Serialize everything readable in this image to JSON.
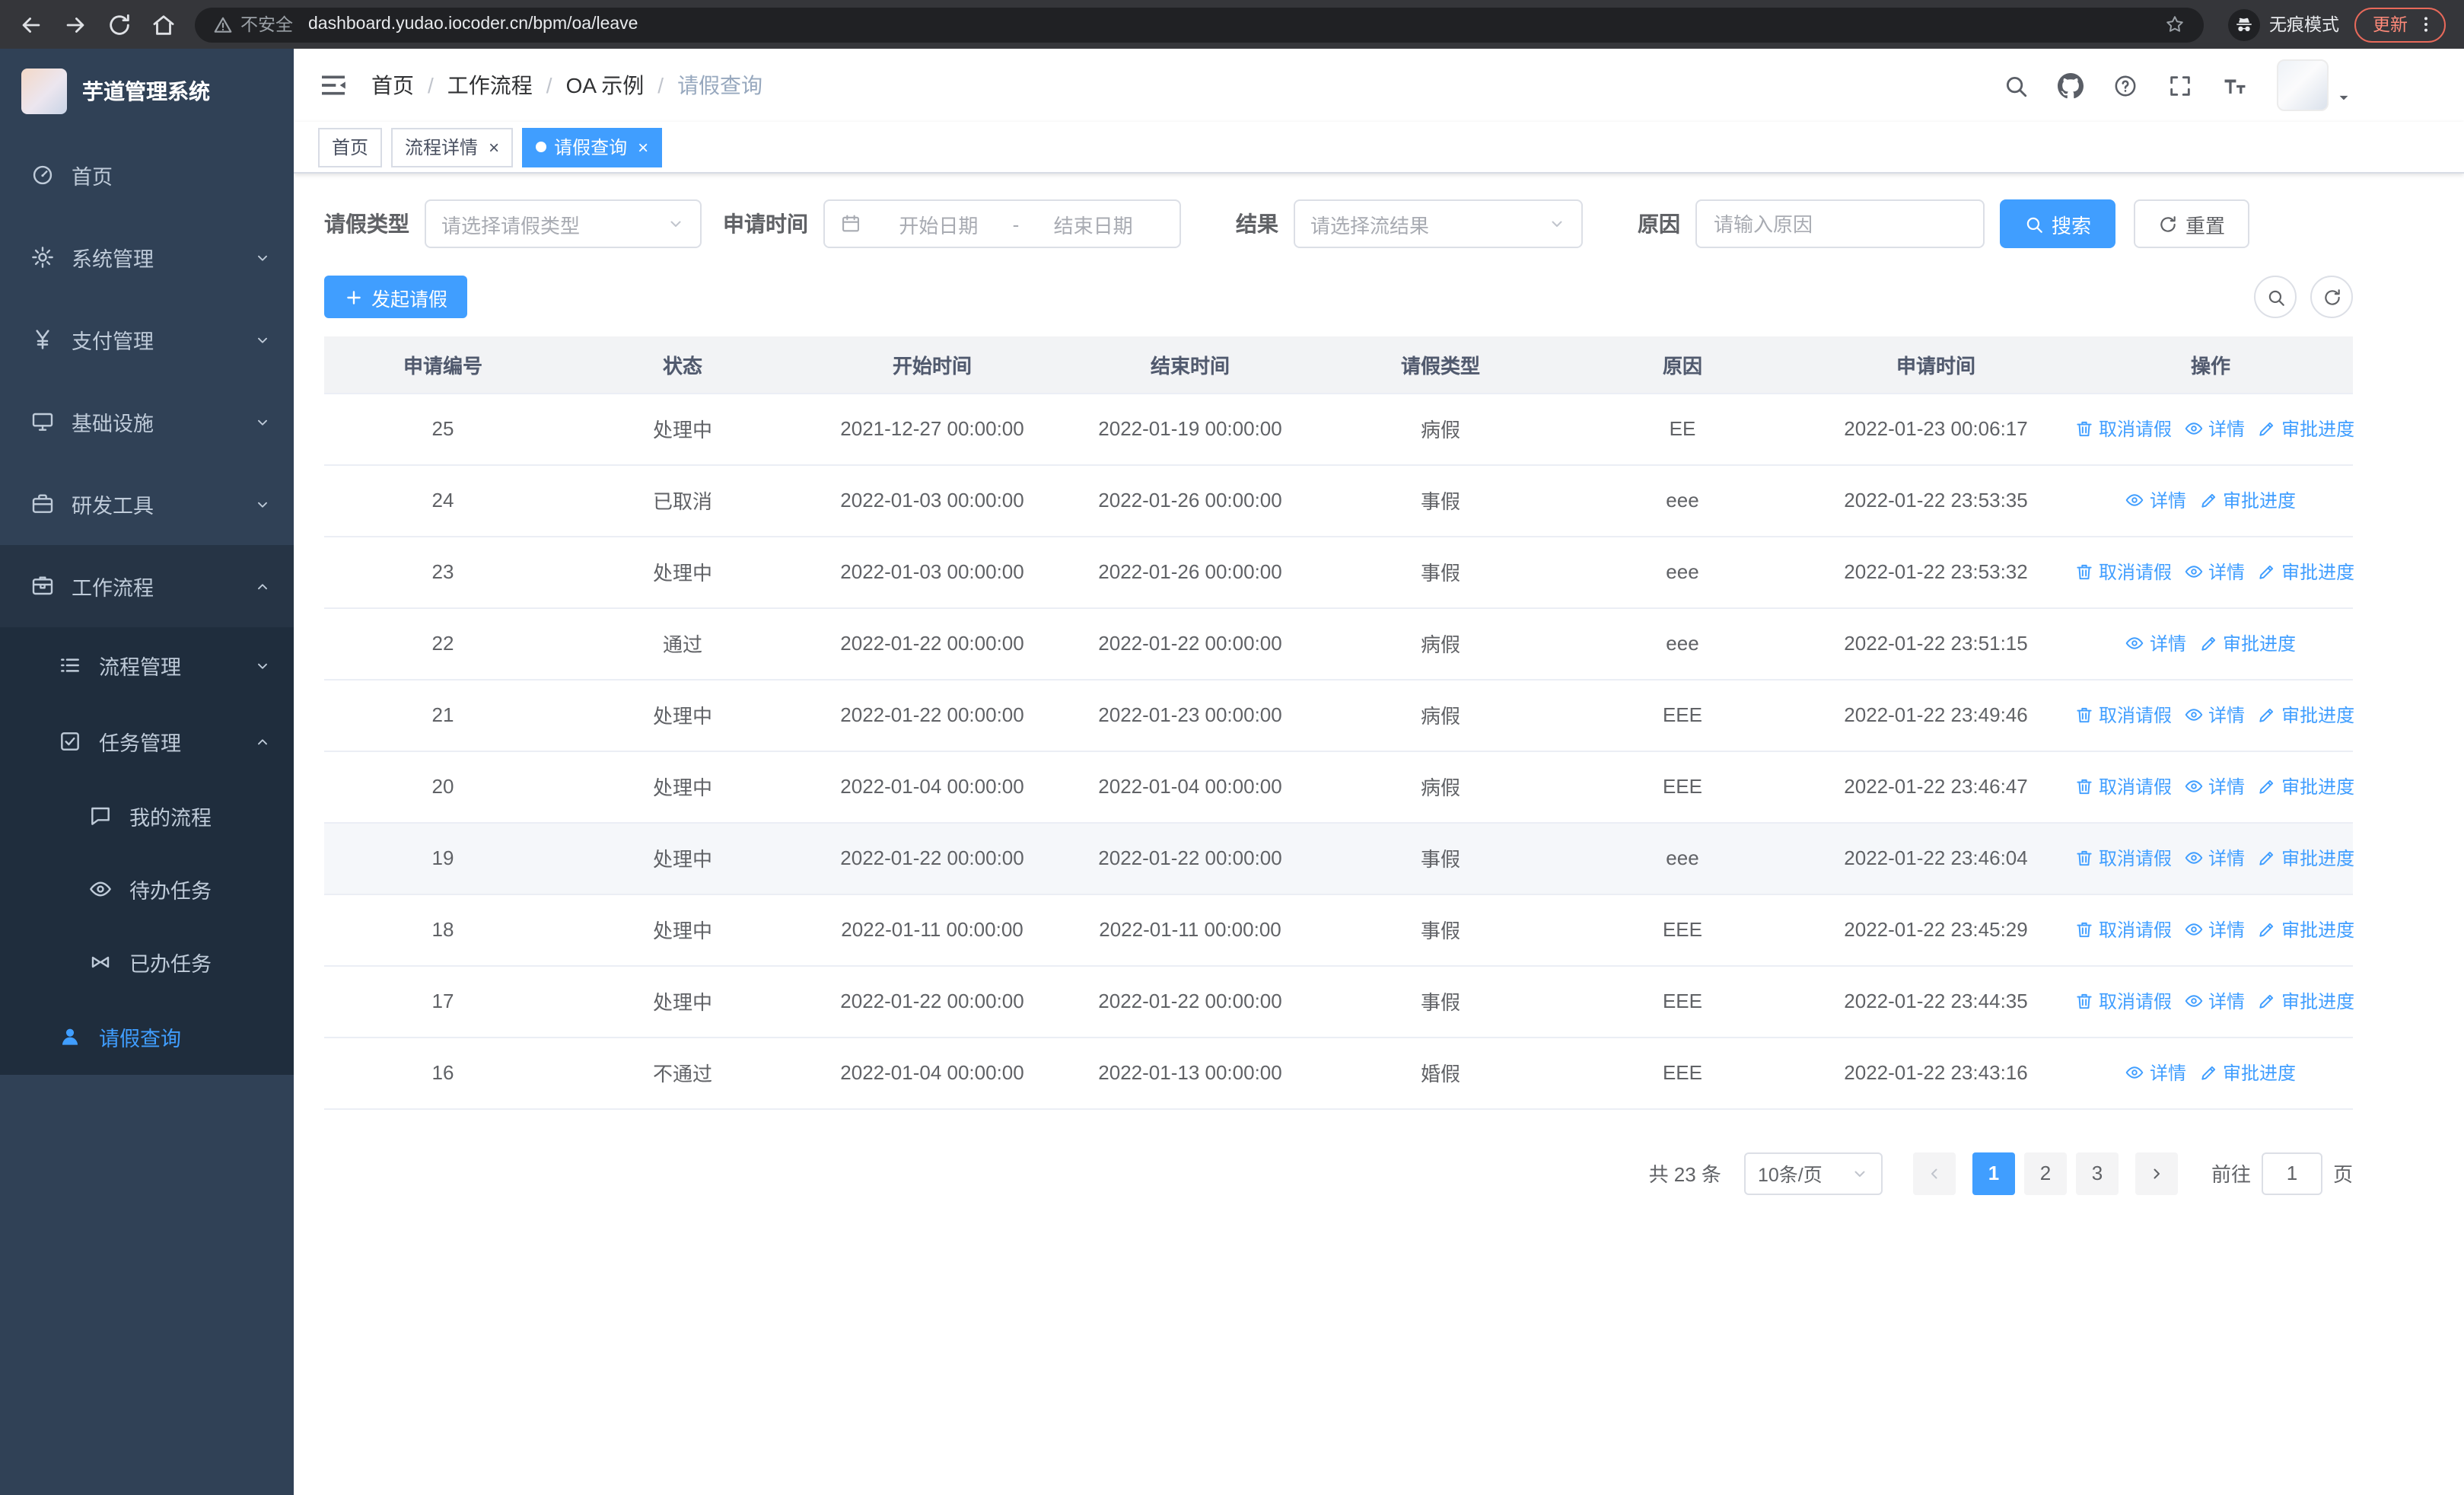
{
  "browser": {
    "security_label": "不安全",
    "url": "dashboard.yudao.iocoder.cn/bpm/oa/leave",
    "incognito_label": "无痕模式",
    "update_label": "更新"
  },
  "sidebar": {
    "logo_title": "芋道管理系统",
    "menu": [
      {
        "name": "home",
        "label": "首页",
        "icon": "dashboard-icon",
        "level": 1
      },
      {
        "name": "system",
        "label": "系统管理",
        "icon": "gear-icon",
        "level": 1,
        "arrow": "down"
      },
      {
        "name": "payment",
        "label": "支付管理",
        "icon": "yen-icon",
        "level": 1,
        "arrow": "down"
      },
      {
        "name": "infrastructure",
        "label": "基础设施",
        "icon": "monitor-icon",
        "level": 1,
        "arrow": "down"
      },
      {
        "name": "dev-tools",
        "label": "研发工具",
        "icon": "briefcase-icon",
        "level": 1,
        "arrow": "down"
      },
      {
        "name": "workflow",
        "label": "工作流程",
        "icon": "workflow-icon",
        "level": 1,
        "arrow": "up",
        "open": true
      },
      {
        "name": "process-management",
        "label": "流程管理",
        "icon": "list-icon",
        "level": 2,
        "arrow": "down",
        "sub": true
      },
      {
        "name": "task-management",
        "label": "任务管理",
        "icon": "task-icon",
        "level": 2,
        "arrow": "up",
        "sub": true
      },
      {
        "name": "my-process",
        "label": "我的流程",
        "icon": "chat-icon",
        "level": 3,
        "sub": true
      },
      {
        "name": "todo-tasks",
        "label": "待办任务",
        "icon": "eye-icon",
        "level": 3,
        "sub": true
      },
      {
        "name": "done-tasks",
        "label": "已办任务",
        "icon": "done-icon",
        "level": 3,
        "sub": true
      },
      {
        "name": "leave-query",
        "label": "请假查询",
        "icon": "user-icon",
        "level": 2,
        "sub": true,
        "active": true
      }
    ]
  },
  "header": {
    "breadcrumb": [
      "首页",
      "工作流程",
      "OA 示例",
      "请假查询"
    ]
  },
  "tags": [
    {
      "name": "home",
      "label": "首页"
    },
    {
      "name": "process-detail",
      "label": "流程详情",
      "closable": true
    },
    {
      "name": "leave-query",
      "label": "请假查询",
      "closable": true,
      "active": true
    }
  ],
  "filters": {
    "type_label": "请假类型",
    "type_placeholder": "请选择请假类型",
    "time_label": "申请时间",
    "start_placeholder": "开始日期",
    "range_separator": "-",
    "end_placeholder": "结束日期",
    "result_label": "结果",
    "result_placeholder": "请选择流结果",
    "reason_label": "原因",
    "reason_placeholder": "请输入原因",
    "search_button": "搜索",
    "reset_button": "重置"
  },
  "toolbar": {
    "create_button": "发起请假"
  },
  "table": {
    "columns": [
      "申请编号",
      "状态",
      "开始时间",
      "结束时间",
      "请假类型",
      "原因",
      "申请时间",
      "操作"
    ],
    "actions": {
      "cancel": "取消请假",
      "detail": "详情",
      "progress": "审批进度"
    },
    "rows": [
      {
        "id": "25",
        "status": "处理中",
        "start": "2021-12-27 00:00:00",
        "end": "2022-01-19 00:00:00",
        "type": "病假",
        "reason": "EE",
        "applied": "2022-01-23 00:06:17",
        "actions": [
          "cancel",
          "detail",
          "progress"
        ]
      },
      {
        "id": "24",
        "status": "已取消",
        "start": "2022-01-03 00:00:00",
        "end": "2022-01-26 00:00:00",
        "type": "事假",
        "reason": "eee",
        "applied": "2022-01-22 23:53:35",
        "actions": [
          "detail",
          "progress"
        ]
      },
      {
        "id": "23",
        "status": "处理中",
        "start": "2022-01-03 00:00:00",
        "end": "2022-01-26 00:00:00",
        "type": "事假",
        "reason": "eee",
        "applied": "2022-01-22 23:53:32",
        "actions": [
          "cancel",
          "detail",
          "progress"
        ]
      },
      {
        "id": "22",
        "status": "通过",
        "start": "2022-01-22 00:00:00",
        "end": "2022-01-22 00:00:00",
        "type": "病假",
        "reason": "eee",
        "applied": "2022-01-22 23:51:15",
        "actions": [
          "detail",
          "progress"
        ]
      },
      {
        "id": "21",
        "status": "处理中",
        "start": "2022-01-22 00:00:00",
        "end": "2022-01-23 00:00:00",
        "type": "病假",
        "reason": "EEE",
        "applied": "2022-01-22 23:49:46",
        "actions": [
          "cancel",
          "detail",
          "progress"
        ]
      },
      {
        "id": "20",
        "status": "处理中",
        "start": "2022-01-04 00:00:00",
        "end": "2022-01-04 00:00:00",
        "type": "病假",
        "reason": "EEE",
        "applied": "2022-01-22 23:46:47",
        "actions": [
          "cancel",
          "detail",
          "progress"
        ]
      },
      {
        "id": "19",
        "status": "处理中",
        "start": "2022-01-22 00:00:00",
        "end": "2022-01-22 00:00:00",
        "type": "事假",
        "reason": "eee",
        "applied": "2022-01-22 23:46:04",
        "actions": [
          "cancel",
          "detail",
          "progress"
        ],
        "hover": true
      },
      {
        "id": "18",
        "status": "处理中",
        "start": "2022-01-11 00:00:00",
        "end": "2022-01-11 00:00:00",
        "type": "事假",
        "reason": "EEE",
        "applied": "2022-01-22 23:45:29",
        "actions": [
          "cancel",
          "detail",
          "progress"
        ]
      },
      {
        "id": "17",
        "status": "处理中",
        "start": "2022-01-22 00:00:00",
        "end": "2022-01-22 00:00:00",
        "type": "事假",
        "reason": "EEE",
        "applied": "2022-01-22 23:44:35",
        "actions": [
          "cancel",
          "detail",
          "progress"
        ]
      },
      {
        "id": "16",
        "status": "不通过",
        "start": "2022-01-04 00:00:00",
        "end": "2022-01-13 00:00:00",
        "type": "婚假",
        "reason": "EEE",
        "applied": "2022-01-22 23:43:16",
        "actions": [
          "detail",
          "progress"
        ]
      }
    ]
  },
  "pagination": {
    "total": "共 23 条",
    "page_size": "10条/页",
    "pages": [
      "1",
      "2",
      "3"
    ],
    "current": "1",
    "goto_label": "前往",
    "goto_value": "1",
    "goto_suffix": "页"
  },
  "colors": {
    "primary": "#409eff",
    "sidebar_bg": "#304156",
    "submenu_bg": "#1f2d3d",
    "table_header_bg": "#f2f3f5",
    "hover_row_bg": "#f5f7fa"
  }
}
